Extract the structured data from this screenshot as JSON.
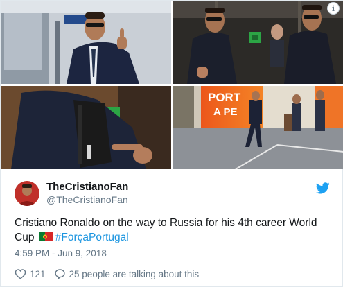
{
  "media": {
    "photos": [
      {
        "name": "photo-thumbs-up",
        "jersey_text": ""
      },
      {
        "name": "photo-walking-sunglasses",
        "jersey_text": ""
      },
      {
        "name": "photo-backpack",
        "jersey_text": ""
      },
      {
        "name": "photo-bus",
        "bus_text_1": "PORT",
        "bus_text_2": "A PE"
      }
    ]
  },
  "author": {
    "display_name": "TheCristianoFan",
    "handle": "@TheCristianoFan"
  },
  "tweet": {
    "text_before": "Cristiano Ronaldo on the way to Russia for his 4th career World Cup",
    "hashtag": "#ForçaPortugal",
    "flag_icon": "portugal-flag-icon",
    "timestamp": "4:59 PM - Jun 9, 2018"
  },
  "actions": {
    "likes": "121",
    "conversation": "25 people are talking about this"
  },
  "colors": {
    "twitter_blue": "#1da1f2",
    "hashtag_blue": "#1b95e0",
    "muted": "#657786",
    "text": "#14171a",
    "bus_orange": "#f26b1d"
  },
  "icons": {
    "info": "info-icon",
    "twitter": "twitter-bird-icon",
    "like": "heart-icon",
    "reply": "speech-bubble-icon"
  }
}
